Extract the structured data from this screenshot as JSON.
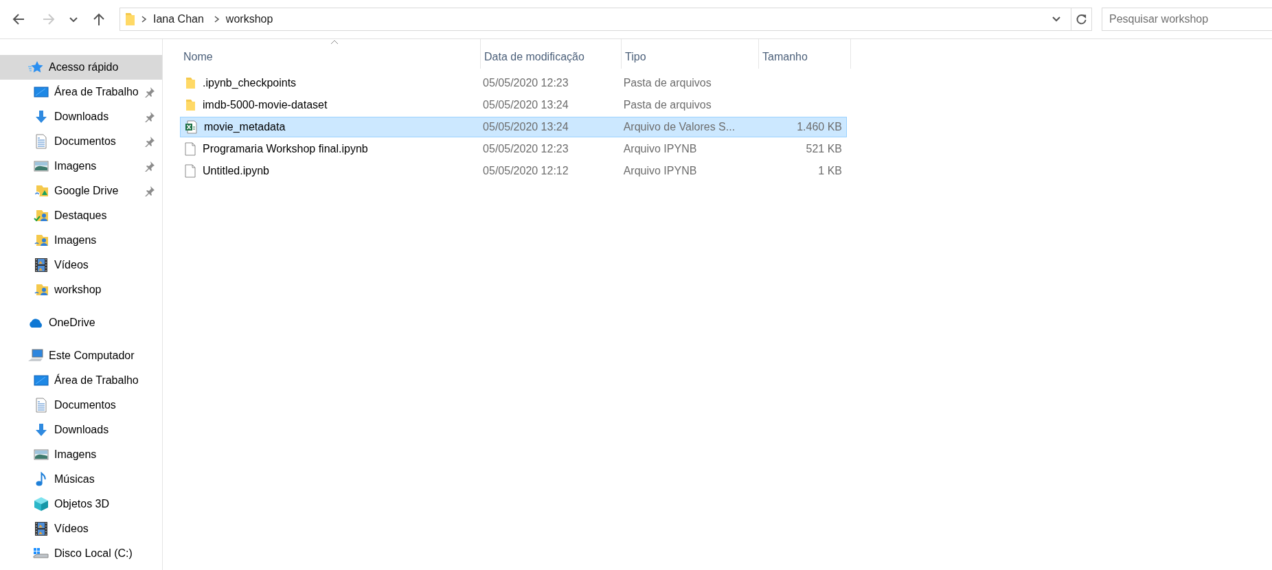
{
  "toolbar": {
    "nav_buttons": [
      {
        "kind": "back",
        "disabled": false
      },
      {
        "kind": "forward",
        "disabled": true
      },
      {
        "kind": "recent",
        "disabled": false
      },
      {
        "kind": "up",
        "disabled": false
      }
    ],
    "address_bar": {
      "crumbs": [
        "Iana Chan",
        "workshop"
      ]
    },
    "search": {
      "placeholder": "Pesquisar workshop"
    }
  },
  "sidebar": {
    "sections": [
      {
        "label": "Acesso rápido",
        "kind": "quick",
        "selected": true,
        "children": [
          {
            "label": "Área de Trabalho",
            "kind": "desktop",
            "pinned": true,
            "selected": false
          },
          {
            "label": "Downloads",
            "kind": "downloads",
            "pinned": true,
            "selected": false
          },
          {
            "label": "Documentos",
            "kind": "documents",
            "pinned": true,
            "selected": false
          },
          {
            "label": "Imagens",
            "kind": "pictures",
            "pinned": true,
            "selected": false
          },
          {
            "label": "Google Drive",
            "kind": "gdrive",
            "pinned": true,
            "selected": false
          },
          {
            "label": "Destaques",
            "kind": "shared",
            "pinned": false,
            "selected": false
          },
          {
            "label": "Imagens",
            "kind": "synced",
            "pinned": false,
            "selected": false
          },
          {
            "label": "Vídeos",
            "kind": "videos",
            "pinned": false,
            "selected": false
          },
          {
            "label": "workshop",
            "kind": "synced",
            "pinned": false,
            "selected": false
          }
        ]
      },
      {
        "label": "OneDrive",
        "kind": "onedrive",
        "selected": false
      },
      {
        "label": "Este Computador",
        "kind": "computer",
        "selected": false,
        "children": [
          {
            "label": "Área de Trabalho",
            "kind": "desktop",
            "selected": false
          },
          {
            "label": "Documentos",
            "kind": "documents",
            "selected": false
          },
          {
            "label": "Downloads",
            "kind": "downloads",
            "selected": false
          },
          {
            "label": "Imagens",
            "kind": "pictures",
            "selected": false
          },
          {
            "label": "Músicas",
            "kind": "music",
            "selected": false
          },
          {
            "label": "Objetos 3D",
            "kind": "objects3d",
            "selected": false
          },
          {
            "label": "Vídeos",
            "kind": "videos",
            "selected": false
          },
          {
            "label": "Disco Local (C:)",
            "kind": "drive",
            "selected": false
          }
        ]
      }
    ]
  },
  "file_list": {
    "columns": [
      {
        "label": "Nome",
        "sorted": true
      },
      {
        "label": "Data de modificação",
        "sorted": false
      },
      {
        "label": "Tipo",
        "sorted": false
      },
      {
        "label": "Tamanho",
        "sorted": false
      }
    ],
    "rows": [
      {
        "name": ".ipynb_checkpoints",
        "kind": "folder",
        "date": "05/05/2020 12:23",
        "type": "Pasta de arquivos",
        "selected": false
      },
      {
        "name": "imdb-5000-movie-dataset",
        "kind": "folder",
        "date": "05/05/2020 13:24",
        "type": "Pasta de arquivos",
        "selected": false
      },
      {
        "name": "movie_metadata",
        "kind": "spreadsheet",
        "date": "05/05/2020 13:24",
        "type": "Arquivo de Valores S...",
        "size": "1.460 KB",
        "selected": true
      },
      {
        "name": "Programaria Workshop final.ipynb",
        "kind": "file",
        "date": "05/05/2020 12:23",
        "type": "Arquivo IPYNB",
        "size": "521 KB",
        "selected": false
      },
      {
        "name": "Untitled.ipynb",
        "kind": "file",
        "date": "05/05/2020 12:12",
        "type": "Arquivo IPYNB",
        "size": "1 KB",
        "selected": false
      }
    ]
  }
}
